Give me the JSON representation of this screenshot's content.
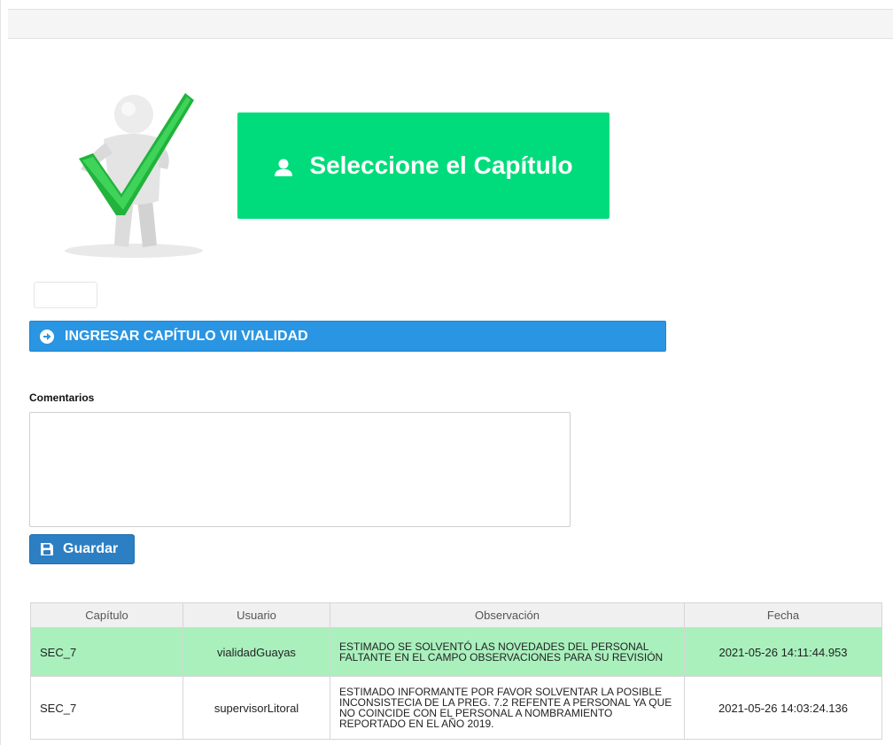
{
  "chapter_button": {
    "label": "Seleccione el Capítulo",
    "icon": "user-icon"
  },
  "ingresar": {
    "label": "INGRESAR CAPÍTULO VII VIALIDAD",
    "icon": "arrow-right-icon"
  },
  "comentarios": {
    "label": "Comentarios",
    "value": ""
  },
  "guardar": {
    "label": "Guardar",
    "icon": "save-icon"
  },
  "table": {
    "headers": [
      "Capítulo",
      "Usuario",
      "Observación",
      "Fecha"
    ],
    "rows": [
      {
        "capitulo": "SEC_7",
        "usuario": "vialidadGuayas",
        "observacion": "ESTIMADO SE SOLVENTÓ LAS NOVEDADES DEL PERSONAL FALTANTE EN EL CAMPO OBSERVACIONES PARA SU REVISIÓN",
        "fecha": "2021-05-26 14:11:44.953"
      },
      {
        "capitulo": "SEC_7",
        "usuario": "supervisorLitoral",
        "observacion": "ESTIMADO INFORMANTE POR FAVOR SOLVENTAR LA POSIBLE INCONSISTECIA DE LA PREG. 7.2 REFENTE A PERSONAL YA QUE NO COINCIDE CON EL PERSONAL A NOMBRAMIENTO REPORTADO EN EL AÑO 2019.",
        "fecha": "2021-05-26 14:03:24.136"
      }
    ]
  },
  "colors": {
    "chapter_button": "#00dc7b",
    "ingresar_bar": "#2a95e2",
    "guardar_button": "#2c7fc3",
    "highlight_row": "#a9f0bd"
  }
}
